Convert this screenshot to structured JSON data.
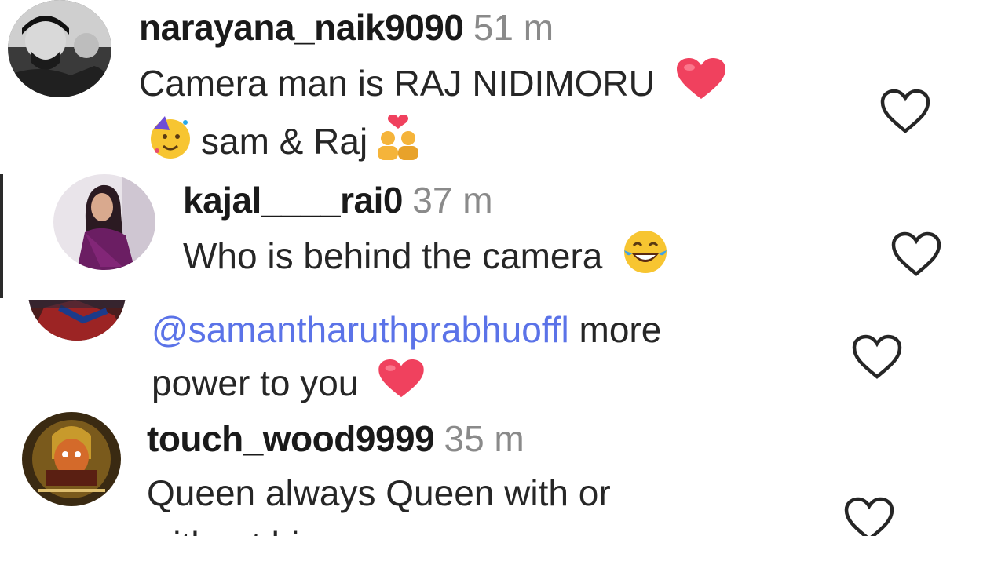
{
  "comments": [
    {
      "username": "narayana_naik9090",
      "time": "51 m",
      "line1": "Camera man is RAJ NIDIMORU",
      "line2": "sam & Raj",
      "emoji": [
        "red-heart-icon",
        "partying-face-icon",
        "couple-with-heart-icon"
      ]
    },
    {
      "username": "kajal____rai0",
      "time": "37 m",
      "line1": "Who is behind the camera",
      "emoji": [
        "laughing-tears-icon"
      ]
    },
    {
      "mention": "@samantharuthprabhuoffl",
      "line1_rest": " more",
      "line2": "power to you",
      "emoji": [
        "red-heart-icon"
      ]
    },
    {
      "username": "touch_wood9999",
      "time": "35 m",
      "line1": "Queen always Queen with or",
      "line2_partial": "without him"
    }
  ],
  "colors": {
    "mention": "#5b73e8",
    "heart_emoji": "#f0415e",
    "like_outline": "#262626",
    "timestamp": "#8a8a8a"
  },
  "icons": {
    "like": "heart-outline-icon"
  }
}
